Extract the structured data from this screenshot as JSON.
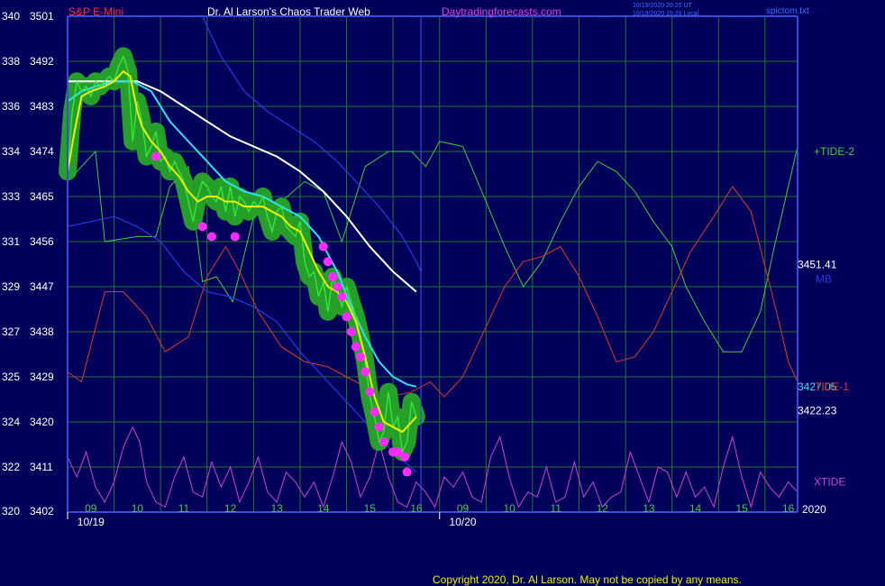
{
  "header": {
    "instrument": "S&P E-Mini",
    "title": "Dr. Al Larson's Chaos Trader Web",
    "site": "Daytradingforecasts.com",
    "stamp_line1": "10/19/2020 20:20 UT",
    "stamp_line2": "10/19/2020 15:20 Local",
    "file": "spictom.txt"
  },
  "footer": {
    "copyright": "Copyright 2020, Dr. Al Larson. May not be copied by any means."
  },
  "colors": {
    "background": "#00005a",
    "frame": "#3a4ad8",
    "grid": "#1f7a2a",
    "tide2": "#3ccf3c",
    "tide1": "#e03a2a",
    "xtide": "#d040d0",
    "price": "#38f038",
    "price_band": "#28a828",
    "avg_fast": "#f0f000",
    "avg_mid": "#30e0f0",
    "avg_slow": "#ffffff",
    "envelope": "#2838e0",
    "markers": "#ff2cff"
  },
  "chart_data": {
    "type": "line",
    "y_axis_left_outer": [
      "340",
      "338",
      "336",
      "334",
      "333",
      "331",
      "329",
      "327",
      "325",
      "324",
      "322",
      "320"
    ],
    "y_axis_left_inner": [
      "3501",
      "3492",
      "3483",
      "3474",
      "3465",
      "3456",
      "3447",
      "3438",
      "3429",
      "3420",
      "3411",
      "3402"
    ],
    "ylim": [
      3402,
      3501
    ],
    "x_hour_labels": [
      {
        "t": 0.5,
        "label": "09"
      },
      {
        "t": 1.5,
        "label": "10"
      },
      {
        "t": 2.5,
        "label": "11"
      },
      {
        "t": 3.5,
        "label": "12"
      },
      {
        "t": 4.5,
        "label": "13"
      },
      {
        "t": 5.5,
        "label": "14"
      },
      {
        "t": 6.5,
        "label": "15"
      },
      {
        "t": 7.5,
        "label": "16"
      },
      {
        "t": 8.5,
        "label": "09"
      },
      {
        "t": 9.5,
        "label": "10"
      },
      {
        "t": 10.5,
        "label": "11"
      },
      {
        "t": 11.5,
        "label": "12"
      },
      {
        "t": 12.5,
        "label": "13"
      },
      {
        "t": 13.5,
        "label": "14"
      },
      {
        "t": 14.5,
        "label": "15"
      },
      {
        "t": 15.5,
        "label": "16"
      }
    ],
    "x_day_labels": [
      {
        "t": 0.5,
        "label": "10/19"
      },
      {
        "t": 8.5,
        "label": "10/20"
      }
    ],
    "xlim": [
      0,
      15.7
    ],
    "right_labels": [
      {
        "y": 3474,
        "text": "+TIDE-2",
        "color": "#3ccf3c"
      },
      {
        "y": 3451.41,
        "text": "3451.41",
        "color": "#ffffff"
      },
      {
        "y": 3448.5,
        "text": "MB",
        "color": "#2838e0"
      },
      {
        "y": 3427.05,
        "text": "3427.05",
        "color": "#30e0f0"
      },
      {
        "y": 3427.05,
        "text": "TIDE-1",
        "color": "#e03a2a"
      },
      {
        "y": 3422.23,
        "text": "3422.23",
        "color": "#ffffff"
      },
      {
        "y": 3408,
        "text": "XTIDE",
        "color": "#d040d0"
      },
      {
        "y": 3402.5,
        "text": "2020",
        "color": "#ffffff"
      }
    ],
    "series": [
      {
        "key": "tide2",
        "x": [
          0,
          0.6,
          0.8,
          1.5,
          1.9,
          2.2,
          2.6,
          2.9,
          3.2,
          3.55,
          4.0,
          4.6,
          5.1,
          5.5,
          5.9,
          6.4,
          6.9,
          7.4,
          7.7,
          8.0,
          8.5,
          9.0,
          9.4,
          9.8,
          10.2,
          10.6,
          11.0,
          11.4,
          11.8,
          12.2,
          12.6,
          13.0,
          13.3,
          13.7,
          14.1,
          14.5,
          14.9,
          15.2,
          15.5,
          15.7
        ],
        "values": [
          3468,
          3474,
          3456,
          3457,
          3457,
          3467,
          3471,
          3448,
          3449,
          3444,
          3461,
          3464,
          3468,
          3466,
          3456,
          3471,
          3474,
          3474,
          3471,
          3476,
          3475,
          3464,
          3455,
          3447,
          3452,
          3460,
          3467,
          3472,
          3470,
          3466,
          3460,
          3455,
          3447,
          3440,
          3434,
          3434,
          3442,
          3455,
          3467,
          3475
        ]
      },
      {
        "key": "tide1",
        "x": [
          0,
          0.3,
          0.8,
          1.2,
          1.7,
          2.1,
          2.6,
          3.0,
          3.4,
          3.7,
          4.1,
          4.6,
          5.1,
          5.6,
          6.0,
          6.4,
          6.9,
          7.4,
          7.8,
          8.1,
          8.5,
          9.0,
          9.4,
          9.8,
          10.2,
          10.6,
          11.0,
          11.4,
          11.8,
          12.2,
          12.6,
          13.0,
          13.4,
          13.9,
          14.3,
          14.7,
          15.0,
          15.3,
          15.5,
          15.7
        ],
        "values": [
          3430,
          3428,
          3446,
          3446,
          3441,
          3434,
          3437,
          3449,
          3455,
          3450,
          3442,
          3435,
          3432,
          3431,
          3429,
          3427,
          3425,
          3426,
          3428,
          3425,
          3429,
          3439,
          3447,
          3452,
          3453,
          3455,
          3449,
          3441,
          3432,
          3433,
          3438,
          3446,
          3454,
          3461,
          3467,
          3462,
          3451,
          3440,
          3432,
          3428
        ]
      },
      {
        "key": "xtide",
        "x": [
          0,
          0.2,
          0.4,
          0.6,
          0.8,
          1.0,
          1.2,
          1.4,
          1.55,
          1.7,
          1.9,
          2.1,
          2.3,
          2.5,
          2.7,
          2.9,
          3.1,
          3.3,
          3.5,
          3.7,
          3.9,
          4.1,
          4.3,
          4.5,
          4.7,
          4.9,
          5.1,
          5.3,
          5.5,
          5.7,
          5.9,
          6.1,
          6.3,
          6.5,
          6.7,
          6.9,
          7.1,
          7.3,
          7.5,
          7.7,
          7.9,
          8.1,
          8.3,
          8.5,
          8.7,
          8.9,
          9.1,
          9.3,
          9.5,
          9.7,
          9.9,
          10.1,
          10.3,
          10.5,
          10.7,
          10.9,
          11.1,
          11.3,
          11.5,
          11.7,
          11.9,
          12.1,
          12.3,
          12.5,
          12.7,
          12.9,
          13.1,
          13.3,
          13.5,
          13.7,
          13.9,
          14.1,
          14.3,
          14.5,
          14.7,
          14.9,
          15.1,
          15.3,
          15.5,
          15.7
        ],
        "values": [
          3413,
          3409,
          3414,
          3407,
          3404,
          3408,
          3415,
          3419,
          3416,
          3408,
          3404,
          3403,
          3409,
          3413,
          3406,
          3405,
          3412,
          3407,
          3411,
          3404,
          3408,
          3413,
          3406,
          3404,
          3410,
          3408,
          3405,
          3408,
          3403,
          3409,
          3416,
          3412,
          3405,
          3409,
          3416,
          3409,
          3404,
          3403,
          3408,
          3406,
          3403,
          3409,
          3407,
          3410,
          3405,
          3404,
          3413,
          3417,
          3409,
          3403,
          3406,
          3405,
          3411,
          3404,
          3405,
          3412,
          3405,
          3408,
          3403,
          3405,
          3406,
          3414,
          3409,
          3404,
          3411,
          3410,
          3405,
          3410,
          3405,
          3407,
          3403,
          3411,
          3417,
          3409,
          3403,
          3410,
          3407,
          3405,
          3408,
          3406
        ]
      },
      {
        "key": "envelope_upper",
        "x": [
          2.9,
          3.3,
          3.8,
          4.3,
          4.8,
          5.3,
          5.8,
          6.2,
          6.7,
          7.2,
          7.5,
          7.6
        ],
        "values": [
          3501,
          3493,
          3486,
          3482,
          3479,
          3476,
          3472,
          3468,
          3463,
          3457,
          3452,
          3450
        ]
      },
      {
        "key": "envelope_lower",
        "x": [
          0,
          0.5,
          1.0,
          1.5,
          2.0,
          2.5,
          3.0,
          3.5,
          4.0,
          4.5,
          5.0,
          5.5,
          6.0,
          6.5,
          7.0,
          7.5
        ],
        "values": [
          3459,
          3460,
          3461,
          3459,
          3456,
          3450,
          3446,
          3445,
          3443,
          3440,
          3434,
          3429,
          3424,
          3419,
          3414,
          3410
        ]
      },
      {
        "key": "avg_slow",
        "x": [
          0,
          0.5,
          1.0,
          1.5,
          2.0,
          2.5,
          3.0,
          3.5,
          4.0,
          4.5,
          5.0,
          5.5,
          6.0,
          6.5,
          7.0,
          7.5
        ],
        "values": [
          3488,
          3488,
          3488,
          3488,
          3486,
          3483,
          3480,
          3477,
          3475,
          3473,
          3470,
          3466,
          3461,
          3455,
          3450,
          3446
        ]
      },
      {
        "key": "avg_mid",
        "x": [
          0,
          0.3,
          0.6,
          1.0,
          1.4,
          1.8,
          2.2,
          2.6,
          3.0,
          3.4,
          3.8,
          4.2,
          4.6,
          5.0,
          5.4,
          5.8,
          6.1,
          6.4,
          6.7,
          7.0,
          7.3,
          7.5
        ],
        "values": [
          3484,
          3486,
          3487,
          3488,
          3488,
          3486,
          3480,
          3476,
          3472,
          3468,
          3466,
          3465,
          3463,
          3461,
          3457,
          3450,
          3443,
          3437,
          3432,
          3429,
          3427.5,
          3427.05
        ]
      },
      {
        "key": "price",
        "x": [
          0,
          0.1,
          0.2,
          0.3,
          0.4,
          0.5,
          0.6,
          0.7,
          0.8,
          0.9,
          1.0,
          1.1,
          1.2,
          1.3,
          1.4,
          1.5,
          1.6,
          1.7,
          1.8,
          1.9,
          2.0,
          2.1,
          2.2,
          2.3,
          2.4,
          2.5,
          2.6,
          2.7,
          2.8,
          2.9,
          3.0,
          3.1,
          3.2,
          3.3,
          3.4,
          3.5,
          3.6,
          3.7,
          3.8,
          3.9,
          4.0,
          4.1,
          4.2,
          4.3,
          4.4,
          4.5,
          4.6,
          4.7,
          4.8,
          4.9,
          5.0,
          5.1,
          5.2,
          5.3,
          5.4,
          5.5,
          5.6,
          5.7,
          5.8,
          5.9,
          6.0,
          6.1,
          6.2,
          6.3,
          6.4,
          6.5,
          6.6,
          6.7,
          6.8,
          6.9,
          7.0,
          7.1,
          7.2,
          7.3,
          7.4,
          7.5
        ],
        "values": [
          3470,
          3482,
          3488,
          3486,
          3487,
          3485,
          3488,
          3487,
          3488,
          3489,
          3488,
          3491,
          3493,
          3490,
          3476,
          3484,
          3480,
          3473,
          3475,
          3478,
          3472,
          3473,
          3470,
          3472,
          3470,
          3468,
          3464,
          3460,
          3465,
          3468,
          3467,
          3465,
          3464,
          3467,
          3462,
          3467,
          3461,
          3465,
          3464,
          3462,
          3464,
          3463,
          3465,
          3461,
          3458,
          3462,
          3463,
          3459,
          3458,
          3457,
          3460,
          3452,
          3449,
          3450,
          3445,
          3448,
          3442,
          3449,
          3446,
          3443,
          3447,
          3444,
          3441,
          3437,
          3432,
          3425,
          3421,
          3416,
          3418,
          3426,
          3419,
          3421,
          3414,
          3416,
          3424,
          3421
        ]
      },
      {
        "key": "avg_fast",
        "x": [
          0,
          0.15,
          0.3,
          0.5,
          0.8,
          1.0,
          1.2,
          1.35,
          1.5,
          1.6,
          1.8,
          2.0,
          2.2,
          2.4,
          2.6,
          2.8,
          3.0,
          3.2,
          3.4,
          3.6,
          3.8,
          4.0,
          4.2,
          4.4,
          4.6,
          4.8,
          5.0,
          5.2,
          5.4,
          5.6,
          5.8,
          6.0,
          6.2,
          6.4,
          6.6,
          6.8,
          7.0,
          7.2,
          7.4,
          7.5
        ],
        "values": [
          3470,
          3478,
          3485,
          3486,
          3487,
          3488,
          3490,
          3489,
          3482,
          3479,
          3476,
          3474,
          3471,
          3469,
          3466,
          3464,
          3465,
          3465,
          3464,
          3464,
          3463,
          3463,
          3463,
          3462,
          3461,
          3459,
          3458,
          3454,
          3450,
          3447,
          3446,
          3444,
          3440,
          3433,
          3425,
          3420,
          3419,
          3418,
          3420,
          3421
        ]
      },
      {
        "key": "markers",
        "x": [
          1.9,
          2.9,
          3.1,
          3.6,
          5.5,
          5.6,
          5.7,
          5.8,
          5.9,
          6.0,
          6.1,
          6.2,
          6.3,
          6.4,
          6.5,
          6.6,
          6.7,
          6.8,
          7.0,
          7.1,
          7.25,
          7.3
        ],
        "values": [
          3473,
          3459,
          3457,
          3457,
          3455,
          3452,
          3449,
          3447,
          3445,
          3441,
          3438,
          3435,
          3433,
          3430,
          3426,
          3422,
          3419,
          3416,
          3414,
          3414,
          3413,
          3410
        ]
      }
    ]
  }
}
